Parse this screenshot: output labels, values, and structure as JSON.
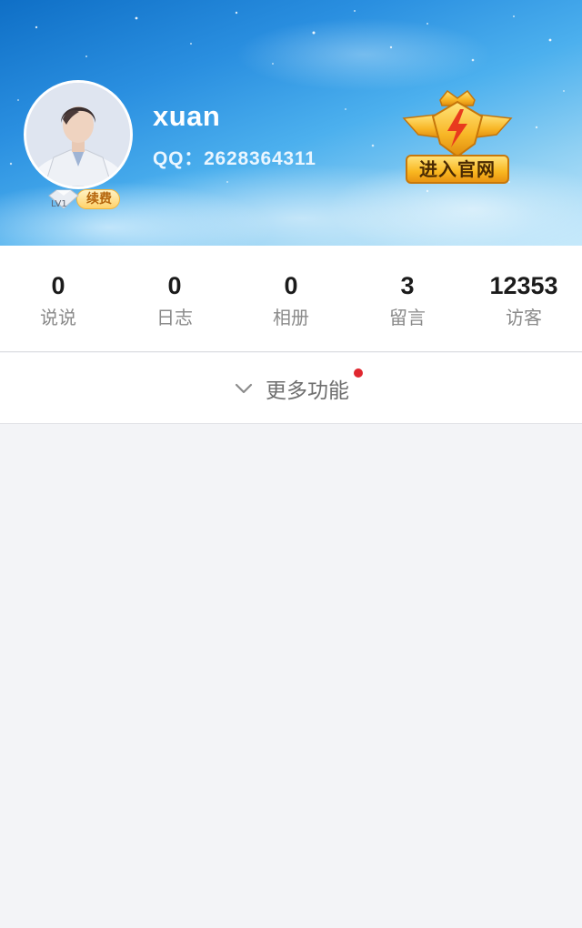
{
  "profile": {
    "username": "xuan",
    "qq_line": "QQ：2628364311",
    "level": "LV1",
    "renew_label": "续费",
    "official_label": "进入官网"
  },
  "stats": [
    {
      "value": "0",
      "label": "说说"
    },
    {
      "value": "0",
      "label": "日志"
    },
    {
      "value": "0",
      "label": "相册"
    },
    {
      "value": "3",
      "label": "留言"
    },
    {
      "value": "12353",
      "label": "访客"
    }
  ],
  "more": {
    "label": "更多功能",
    "has_notification": true
  },
  "icons": {
    "official_badge": "lightning-wings-icon",
    "expand": "chevron-down-icon",
    "level": "diamond-level-icon"
  },
  "colors": {
    "banner_top": "#0f6fc6",
    "banner_bottom": "#c6e9fb",
    "notification_dot": "#e0272f",
    "page_bg": "#f3f4f7"
  }
}
